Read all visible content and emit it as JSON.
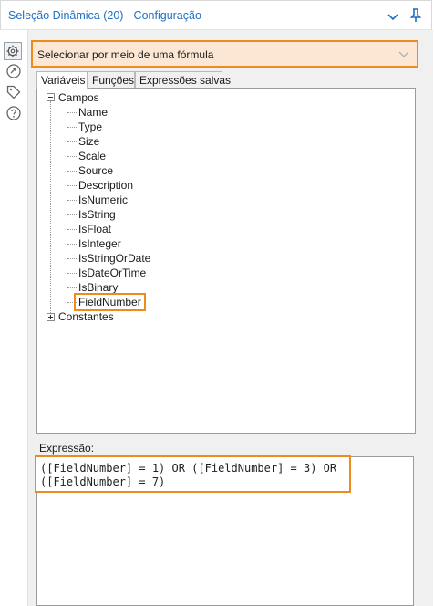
{
  "window": {
    "title": "Seleção Dinâmica (20) - Configuração"
  },
  "sidebar": {
    "dots": "..."
  },
  "mode_dropdown": {
    "selected": "Selecionar por meio de uma fórmula"
  },
  "tabs": [
    "Variáveis",
    "Funções",
    "Expressões salvas"
  ],
  "tree": {
    "campos_label": "Campos",
    "fields": [
      "Name",
      "Type",
      "Size",
      "Scale",
      "Source",
      "Description",
      "IsNumeric",
      "IsString",
      "IsFloat",
      "IsInteger",
      "IsStringOrDate",
      "IsDateOrTime",
      "IsBinary",
      "FieldNumber"
    ],
    "constantes_label": "Constantes"
  },
  "expression": {
    "label": "Expressão:",
    "line1": "([FieldNumber] = 1) OR ([FieldNumber] = 3) OR",
    "line2": "([FieldNumber] = 7)"
  },
  "colors": {
    "accent_orange": "#ee8b1f",
    "title_blue": "#1f6fc2",
    "dropdown_fill": "#fbe7d4"
  }
}
